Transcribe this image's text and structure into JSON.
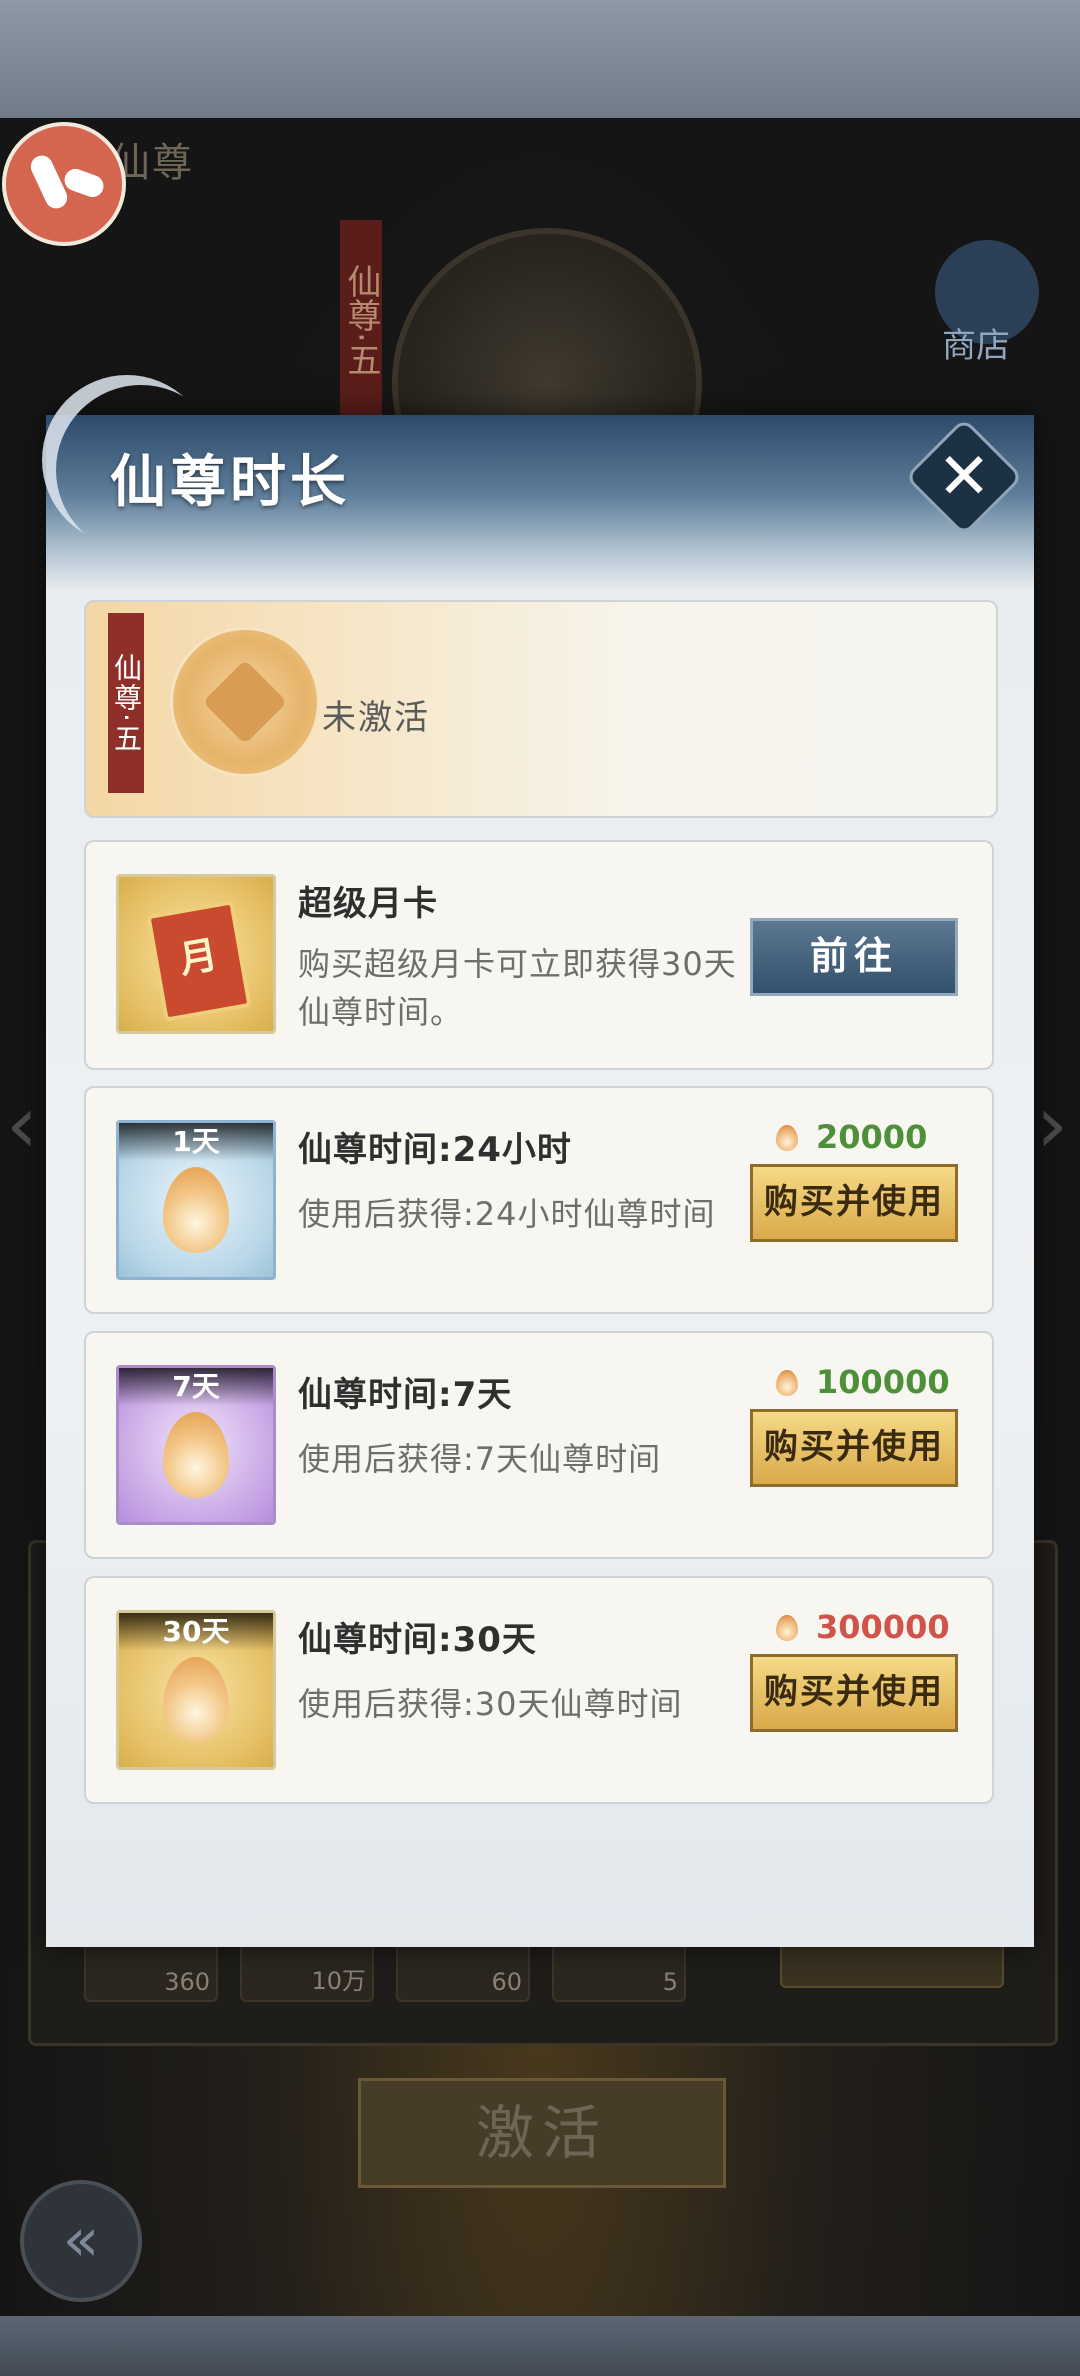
{
  "background": {
    "title": "仙尊",
    "rank_banner": "仙尊·五",
    "shop_label": "商店",
    "item_counts": [
      "360",
      "10万",
      "60",
      "5"
    ],
    "activate_label": "激活"
  },
  "dialog": {
    "title": "仙尊时长",
    "close_symbol": "✕",
    "status": {
      "rank_tag": "仙尊·五",
      "text": "未激活"
    },
    "cards": [
      {
        "icon": "month-card-icon",
        "icon_text": "月",
        "title": "超级月卡",
        "description": "购买超级月卡可立即获得30天仙尊时间。",
        "button": "前往"
      },
      {
        "icon": "flame-icon",
        "tag": "1天",
        "title": "仙尊时间:24小时",
        "description": "使用后获得:24小时仙尊时间",
        "price": "20000",
        "price_color": "#4e8f3a",
        "button": "购买并使用"
      },
      {
        "icon": "flame-icon",
        "tag": "7天",
        "title": "仙尊时间:7天",
        "description": "使用后获得:7天仙尊时间",
        "price": "100000",
        "price_color": "#4e8f3a",
        "button": "购买并使用"
      },
      {
        "icon": "flame-icon",
        "tag": "30天",
        "title": "仙尊时间:30天",
        "description": "使用后获得:30天仙尊时间",
        "price": "300000",
        "price_color": "#d0544a",
        "button": "购买并使用"
      }
    ]
  }
}
